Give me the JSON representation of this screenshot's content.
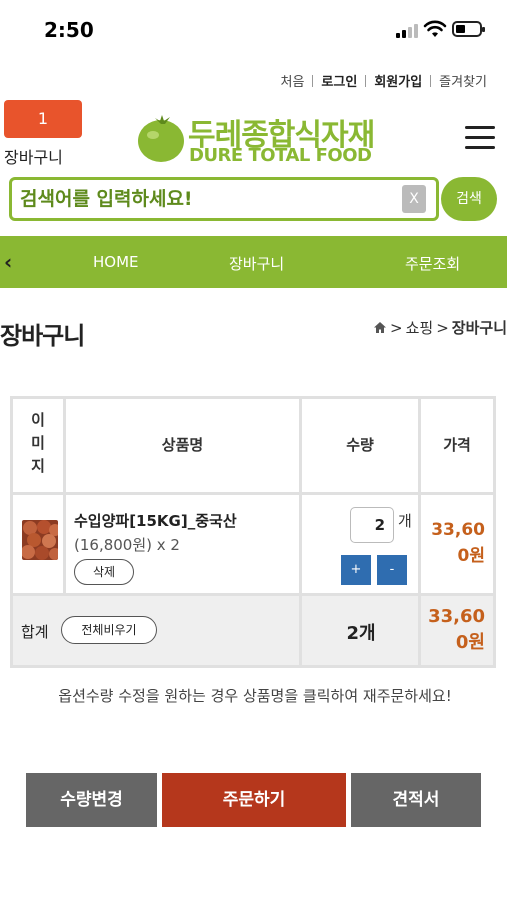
{
  "status_bar": {
    "time": "2:50"
  },
  "top_links": [
    {
      "label": "처음",
      "strong": false
    },
    {
      "label": "로그인",
      "strong": true
    },
    {
      "label": "회원가입",
      "strong": true
    },
    {
      "label": "즐겨찾기",
      "strong": false
    }
  ],
  "header": {
    "cart_count": "1",
    "cart_label": "장바구니",
    "logo_kr": "두레종합식자재",
    "logo_en": "DURE TOTAL FOOD",
    "menu_icon": "hamburger-menu-icon"
  },
  "search": {
    "placeholder": "검색어를 입력하세요!",
    "clear_label": "X",
    "button_label": "검색"
  },
  "nav": {
    "back_icon": "chevron-left-icon",
    "back_glyph": "‹",
    "items": [
      "HOME",
      "장바구니",
      "주문조회"
    ]
  },
  "page": {
    "title": "장바구니",
    "breadcrumb": [
      "쇼핑",
      "장바구니"
    ],
    "breadcrumb_sep": ">"
  },
  "table": {
    "headers": {
      "image": "이\n미\n지",
      "name": "상품명",
      "qty": "수량",
      "price": "가격"
    },
    "items": [
      {
        "name": "수입양파[15KG]_중국산",
        "detail": "(16,800원) x 2",
        "delete_label": "삭제",
        "qty": "2",
        "unit": "개",
        "plus": "+",
        "minus": "-",
        "price_line1": "33,60",
        "price_line2": "0원"
      }
    ],
    "footer": {
      "label": "합계",
      "clear_all": "전체비우기",
      "total_qty": "2개",
      "total_line1": "33,60",
      "total_line2": "0원"
    }
  },
  "notice": "옵션수량 수정을 원하는 경우 상품명을 클릭하여 재주문하세요!",
  "actions": [
    {
      "label": "수량변경",
      "color": "#666666"
    },
    {
      "label": "주문하기",
      "color": "#b5371c"
    },
    {
      "label": "견적서",
      "color": "#666666"
    }
  ],
  "colors": {
    "brand_green": "#8ab833",
    "cart_orange": "#e8542c",
    "price_orange": "#c5601c",
    "stepper_blue": "#2f6db0"
  }
}
